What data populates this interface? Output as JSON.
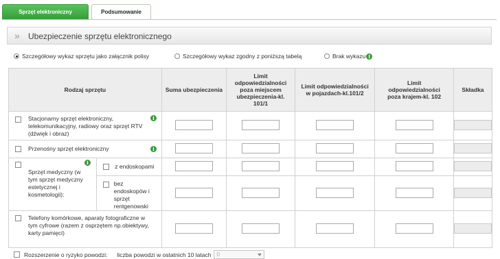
{
  "tabs": [
    {
      "label": "Sprzęt elektroniczny"
    },
    {
      "label": "Podsumowanie"
    }
  ],
  "section": {
    "title": "Ubezpieczenie sprzętu elektronicznego",
    "chevron": "»"
  },
  "radios": [
    {
      "label": "Szczegółowy wykaz sprzętu jako załącznik polisy",
      "checked": true
    },
    {
      "label": "Szczegółowy wykaz zgodny z poniższą tabelą",
      "checked": false
    },
    {
      "label": "Brak wykazu",
      "checked": false
    }
  ],
  "table": {
    "headers": [
      "Rodzaj sprzętu",
      "Suma ubezpieczenia",
      "Limit odpowiedzialności poza miejscem ubezpieczenia-kl. 101/1",
      "Limit odpowiedzialności w pojazdach-kl.101/2",
      "Limit odpowiedzialności poza krajem-kl. 102",
      "Składka"
    ],
    "rows": [
      {
        "label": "Stacjonarny sprzęt elektroniczny, telekomunikacyjny, radiowy oraz sprzęt RTV (dźwięk i obraz)"
      },
      {
        "label": "Przenośny sprzęt elektroniczny"
      },
      {
        "label": "Sprzęt medyczny (w tym sprzęt medyczny estetycznej i kosmetologii):",
        "sub": [
          "z endoskopami",
          "bez endoskopów i sprzęt rentgenowski"
        ]
      },
      {
        "label": "Telefony komórkowe, aparaty fotograficzne w tym cyfrowe (razem z osprzętem np.obiektywy, karty pamięci)"
      }
    ]
  },
  "bottom": {
    "checkbox_label": "Rozszerzenie o ryzyko powodzi:",
    "count_label": "liczba powodzi w ostatnich 10 latach",
    "select_value": "0"
  },
  "colors": {
    "tab_active": "#46b04a",
    "info_icon": "#3a9a3a"
  },
  "icons": {
    "info": "i"
  }
}
